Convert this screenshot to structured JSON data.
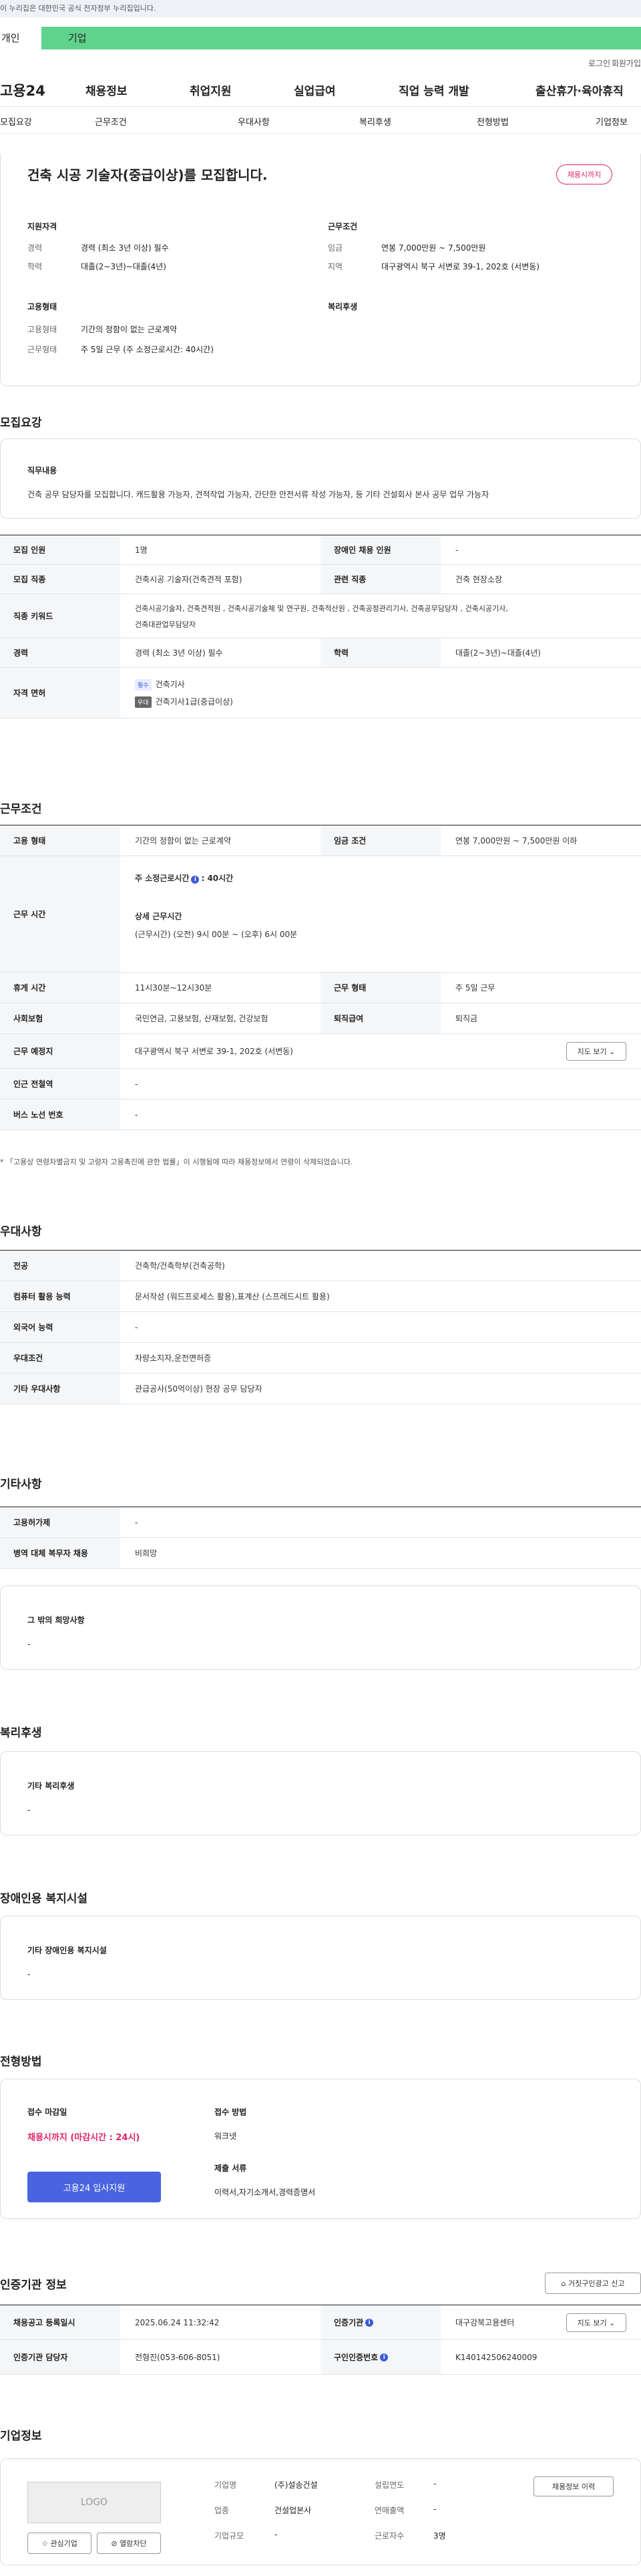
{
  "gov_notice": "이 누리집은 대한민국 공식 전자정부 누리집입니다.",
  "tabs": {
    "individual": "개인",
    "corporate": "기업"
  },
  "util": {
    "login": "로그인",
    "join": "회원가입"
  },
  "gnb": {
    "logo": "고용24",
    "menu": [
      "채용정보",
      "취업지원",
      "실업급여",
      "직업 능력 개발",
      "출산휴가·육아휴직"
    ]
  },
  "lnb": [
    "모집요강",
    "근무조건",
    "우대사항",
    "복리후생",
    "전형방법",
    "기업정보"
  ],
  "summary": {
    "title": "건축 시공 기술자(중급이상)를 모집합니다.",
    "badge": "채용시까지",
    "qual_head": "지원자격",
    "cond_head": "근무조건",
    "career_l": "경력",
    "career_v": "경력 (최소 3년 이상) 필수",
    "edu_l": "학력",
    "edu_v": "대졸(2~3년)~대졸(4년)",
    "wage_l": "임금",
    "wage_v": "연봉 7,000만원 ~ 7,500만원",
    "region_l": "지역",
    "region_v": "대구광역시 북구 서변로 39-1, 202호 (서변동)",
    "emp_head": "고용형태",
    "welfare_head": "복리후생",
    "emptype_l": "고용형태",
    "emptype_v": "기간의 정함이 없는 근로계약",
    "worktype_l": "근무형태",
    "worktype_v": "주 5일 근무 (주 소정근로시간: 40시간)"
  },
  "recruit": {
    "title": "모집요강",
    "duty_head": "직무내용",
    "duty_text": "건축 공무 담당자를 모집합니다. 캐드활용 가능자, 견적작업 가능자, 간단한 안전서류 작성 가능자, 등 기타 건설회사 본사 공무 업무 가능자",
    "count_l": "모집 인원",
    "count_v": "1명",
    "disabled_l": "장애인 채용 인원",
    "disabled_v": "-",
    "job_l": "모집 직종",
    "job_v": "건축시공 기술자(건축견적 포함)",
    "related_l": "관련 직종",
    "related_v": "건축 현장소장",
    "keyword_l": "직종 키워드",
    "keyword_v1": "건축시공기술자, 건축견적원 , 건축시공기술체 및 연구원, 건축적산원 , 건축공정관리기사, 건축공무담당자 , 건축시공기사,",
    "keyword_v2": "건축대관업무담당자",
    "career_l": "경력",
    "career_v": "경력 (최소 3년 이상) 필수",
    "edu_l": "학력",
    "edu_v": "대졸(2~3년)~대졸(4년)",
    "license_l": "자격 면허",
    "badge_req": "필수",
    "license1": "건축기사",
    "badge_pref": "우대",
    "license2": "건축기사1급(중급이상)"
  },
  "work": {
    "title": "근무조건",
    "emptype_l": "고용 형태",
    "emptype_v": "기간의 정함이 없는 근로계약",
    "wage_l": "임금 조건",
    "wage_v": "연봉 7,000만원 ~ 7,500만원 이하",
    "hours_l": "근무 시간",
    "hours_week": "주 소정근로시간",
    "hours_week_v": ": 40시간",
    "hours_detail": "상세 근무시간",
    "hours_detail_v": "(근무시간) (오전) 9시 00분 ~ (오후) 6시 00분",
    "break_l": "휴게 시간",
    "break_v": "11시30분~12시30분",
    "worktype_l": "근무 형태",
    "worktype_v": "주 5일 근무",
    "insurance_l": "사회보험",
    "insurance_v": "국민연금, 고용보험, 산재보험, 건강보험",
    "retire_l": "퇴직급여",
    "retire_v": "퇴직금",
    "place_l": "근무 예정지",
    "place_v": "대구광역시 북구 서변로 39-1, 202호 (서변동)",
    "map_btn": "지도 보기",
    "subway_l": "인근 전철역",
    "subway_v": "-",
    "bus_l": "버스 노선 번호",
    "bus_v": "-",
    "note": "* 「고용상 연령차별금지 및 고령자 고용촉진에 관한 법률」이 시행됨에 따라 채용정보에서 연령이 삭제되었습니다."
  },
  "pref": {
    "title": "우대사항",
    "major_l": "전공",
    "major_v": "건축학/건축학부(건축공학)",
    "computer_l": "컴퓨터 활용 능력",
    "computer_v": "문서작성 (워드프로세스 활용),표계산 (스프레드시트 활용)",
    "lang_l": "외국어 능력",
    "lang_v": "-",
    "cond_l": "우대조건",
    "cond_v": "차량소지자,운전면허증",
    "etc_l": "기타 우대사항",
    "etc_v": "관급공사(50억이상) 현장 공무 담당자"
  },
  "etc": {
    "title": "기타사항",
    "permit_l": "고용허가제",
    "permit_v": "-",
    "military_l": "병역 대체 복무자 채용",
    "military_v": "비희망",
    "wish_head": "그 밖의 희망사항",
    "wish_v": "-"
  },
  "welfare": {
    "title": "복리후생",
    "head": "기타 복리후생",
    "v": "-"
  },
  "facility": {
    "title": "장애인용 복지시설",
    "head": "기타 장애인용 복지시설",
    "v": "-"
  },
  "process": {
    "title": "전형방법",
    "deadline_l": "접수 마감일",
    "deadline_v": "채용시까지 (마감시간 : 24시)",
    "method_l": "접수 방법",
    "method_v": "워크넷",
    "docs_l": "제출 서류",
    "docs_v": "이력서,자기소개서,경력증명서",
    "apply_btn": "고용24 입사지원"
  },
  "agency": {
    "title": "인증기관 정보",
    "report_btn": "거짓구인광고 신고",
    "reg_l": "채용공고 등록일시",
    "reg_v": "2025.06.24 11:32:42",
    "org_l": "인증기관",
    "org_v": "대구강북고용센터",
    "manager_l": "인증기관 담당자",
    "manager_v": "전형진(053-606-8051)",
    "num_l": "구인인증번호",
    "num_v": "K140142506240009",
    "map_btn": "지도 보기"
  },
  "company": {
    "title": "기업정보",
    "logo": "LOGO",
    "fav_btn": "관심기업",
    "block_btn": "열람차단",
    "history_btn": "채용정보 이력",
    "name_l": "기업명",
    "name_v": "(주)설송건설",
    "year_l": "설립연도",
    "year_v": "-",
    "biz_l": "업종",
    "biz_v": "건설업본사",
    "sales_l": "연매출액",
    "sales_v": "-",
    "size_l": "기업규모",
    "size_v": "-",
    "emp_l": "근로자수",
    "emp_v": "3명"
  },
  "colors": {
    "accent": "#5fd38d",
    "apply": "#4a63e0",
    "deadline": "#e0246b"
  }
}
